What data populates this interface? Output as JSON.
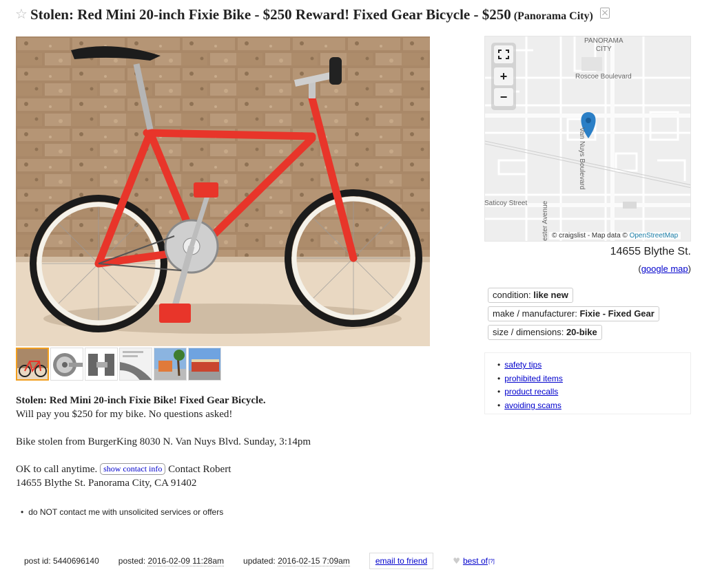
{
  "title": {
    "text": "Stolen: Red Mini 20-inch Fixie Bike - $250 Reward! Fixed Gear Bicycle - $250",
    "location": "(Panorama City)"
  },
  "map": {
    "labels": {
      "area": "PANORAMA\nCITY",
      "area_line1": "PANORAMA",
      "area_line2": "CITY",
      "roscoe": "Roscoe Boulevard",
      "van_nuys": "Van Nuys Boulevard",
      "saticoy": "Saticoy Street",
      "sepulveda": "ester Avenue"
    },
    "controls": {
      "zoom_in": "+",
      "zoom_out": "−"
    },
    "attribution": "© craigslist - Map data ©",
    "attribution_link": "OpenStreetMap",
    "address": "14655 Blythe St.",
    "google_map_open": "(",
    "google_map_link": "google map",
    "google_map_close": ")"
  },
  "attributes": [
    {
      "label": "condition: ",
      "value": "like new"
    },
    {
      "label": "make / manufacturer: ",
      "value": "Fixie - Fixed Gear"
    },
    {
      "label": "size / dimensions: ",
      "value": "20-bike"
    }
  ],
  "safety_links": [
    "safety tips",
    "prohibited items",
    "product recalls",
    "avoiding scams"
  ],
  "body": {
    "headline": "Stolen: Red Mini 20-inch Fixie Bike! Fixed Gear Bicycle.",
    "line2": "Will pay you $250 for my bike. No questions asked!",
    "line3": "Bike stolen from BurgerKing 8030 N. Van Nuys Blvd. Sunday, 3:14pm",
    "call_prefix": "OK to call anytime.",
    "contact_button": "show contact info",
    "contact_name": "Contact Robert",
    "address_line": "14655 Blythe St. Panorama City, CA 91402"
  },
  "notices": [
    "do NOT contact me with unsolicited services or offers"
  ],
  "footer": {
    "post_id_label": "post id: ",
    "post_id": "5440696140",
    "posted_label": "posted: ",
    "posted": "2016-02-09 11:28am",
    "updated_label": "updated: ",
    "updated": "2016-02-15 7:09am",
    "email_button": "email to friend",
    "best_of": "best of",
    "best_of_ext": "[?]"
  },
  "colors": {
    "link": "#0000cc",
    "bike_frame": "#e8352a",
    "selected_thumb": "#f29f1f",
    "map_pin": "#2b7fc6"
  },
  "icons": {
    "favorite": "star-icon",
    "hide": "hide-icon",
    "fullscreen": "fullscreen-icon",
    "pin": "map-pin-icon",
    "heart": "heart-icon"
  }
}
